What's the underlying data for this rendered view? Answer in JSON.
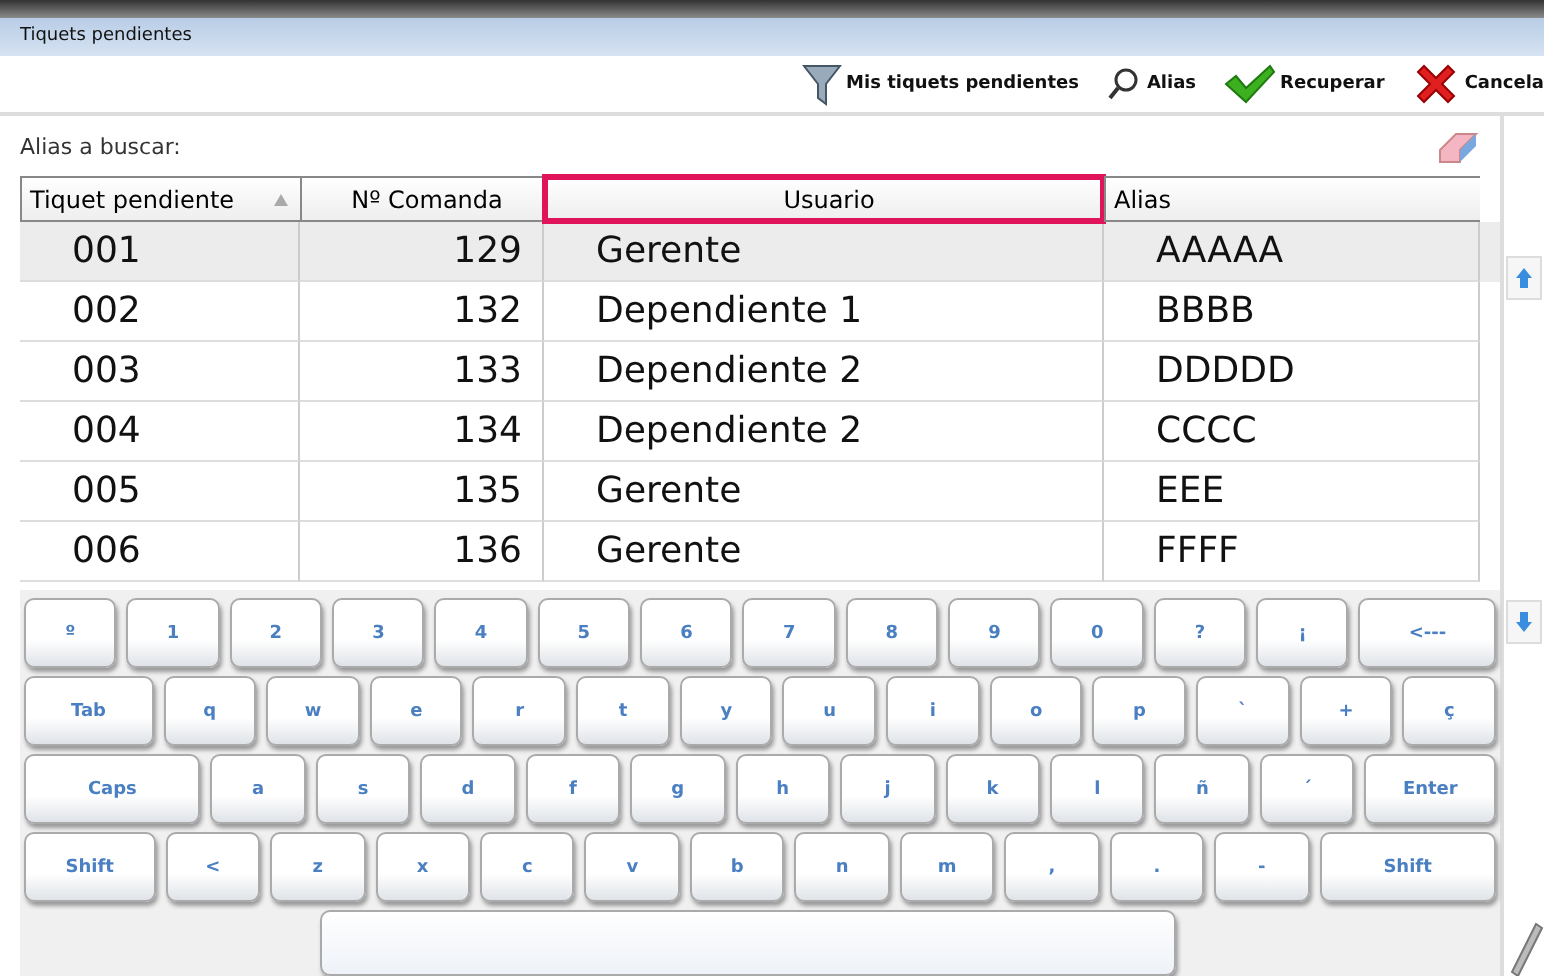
{
  "window": {
    "title": "Tiquets pendientes"
  },
  "toolbar": [
    {
      "kind": "filter",
      "label": "Mis tiquets pendientes"
    },
    {
      "kind": "search",
      "label": "Alias"
    },
    {
      "kind": "check",
      "label": "Recuperar"
    },
    {
      "kind": "cross",
      "label": "Cancela"
    }
  ],
  "search": {
    "label": "Alias a buscar:"
  },
  "table": {
    "columns": [
      {
        "label": "Tiquet pendiente",
        "sorted": true,
        "highlighted": false
      },
      {
        "label": "Nº Comanda",
        "sorted": false,
        "highlighted": false
      },
      {
        "label": "Usuario",
        "sorted": false,
        "highlighted": true
      },
      {
        "label": "Alias",
        "sorted": false,
        "highlighted": false
      }
    ],
    "rows": [
      {
        "cells": [
          "001",
          "129",
          "Gerente",
          "AAAAA"
        ],
        "selected": true
      },
      {
        "cells": [
          "002",
          "132",
          "Dependiente 1",
          "BBBB"
        ],
        "selected": false
      },
      {
        "cells": [
          "003",
          "133",
          "Dependiente 2",
          "DDDDD"
        ],
        "selected": false
      },
      {
        "cells": [
          "004",
          "134",
          "Dependiente 2",
          "CCCC"
        ],
        "selected": false
      },
      {
        "cells": [
          "005",
          "135",
          "Gerente",
          "EEE"
        ],
        "selected": false
      },
      {
        "cells": [
          "006",
          "136",
          "Gerente",
          "FFFF"
        ],
        "selected": false
      }
    ]
  },
  "keyboard": [
    [
      "º",
      "1",
      "2",
      "3",
      "4",
      "5",
      "6",
      "7",
      "8",
      "9",
      "0",
      "?",
      "¡",
      "<---"
    ],
    [
      "Tab",
      "q",
      "w",
      "e",
      "r",
      "t",
      "y",
      "u",
      "i",
      "o",
      "p",
      "`",
      "+",
      "ç"
    ],
    [
      "Caps",
      "a",
      "s",
      "d",
      "f",
      "g",
      "h",
      "j",
      "k",
      "l",
      "ñ",
      "´",
      "Enter"
    ],
    [
      "Shift",
      "<",
      "z",
      "x",
      "c",
      "v",
      "b",
      "n",
      "m",
      ",",
      ".",
      "-",
      "Shift"
    ]
  ]
}
